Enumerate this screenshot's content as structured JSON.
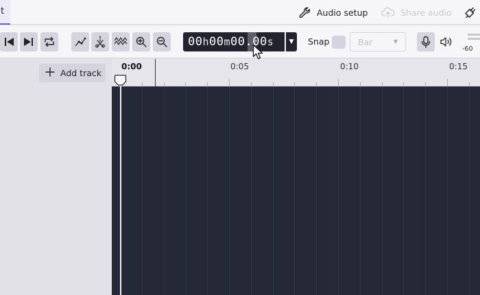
{
  "top_bar": {
    "tab_fragment": "t",
    "audio_setup_label": "Audio setup",
    "share_audio_label": "Share audio"
  },
  "toolbar": {
    "timecode": {
      "hours": "00",
      "h_unit": "h",
      "minutes": "00",
      "m_unit": "m",
      "seconds": "00.00",
      "s_unit": "s"
    },
    "snap_label": "Snap",
    "snap_select_value": "Bar",
    "meter_value": "-60"
  },
  "tracks_panel": {
    "add_track_label": "Add track"
  },
  "timeline": {
    "ruler_labels": [
      "0:00",
      "0:05",
      "0:10",
      "0:15"
    ]
  },
  "colors": {
    "accent": "#6b5fd6",
    "canvas_background": "#252836",
    "toolbar_button": "#d5d4de"
  },
  "icons": {
    "audio_setup": "wrench-icon",
    "share_audio": "cloud-upload-icon",
    "plugin": "plug-icon",
    "skip_to_start": "skip-to-start-icon",
    "skip_to_end": "skip-to-end-icon",
    "loop": "loop-icon",
    "envelope": "envelope-tool-icon",
    "multi_tool": "multi-tool-icon",
    "silence": "zigzag-icon",
    "zoom_in": "zoom-in-icon",
    "zoom_out": "zoom-out-icon",
    "microphone": "microphone-icon",
    "speaker": "speaker-icon",
    "add": "plus-icon"
  }
}
